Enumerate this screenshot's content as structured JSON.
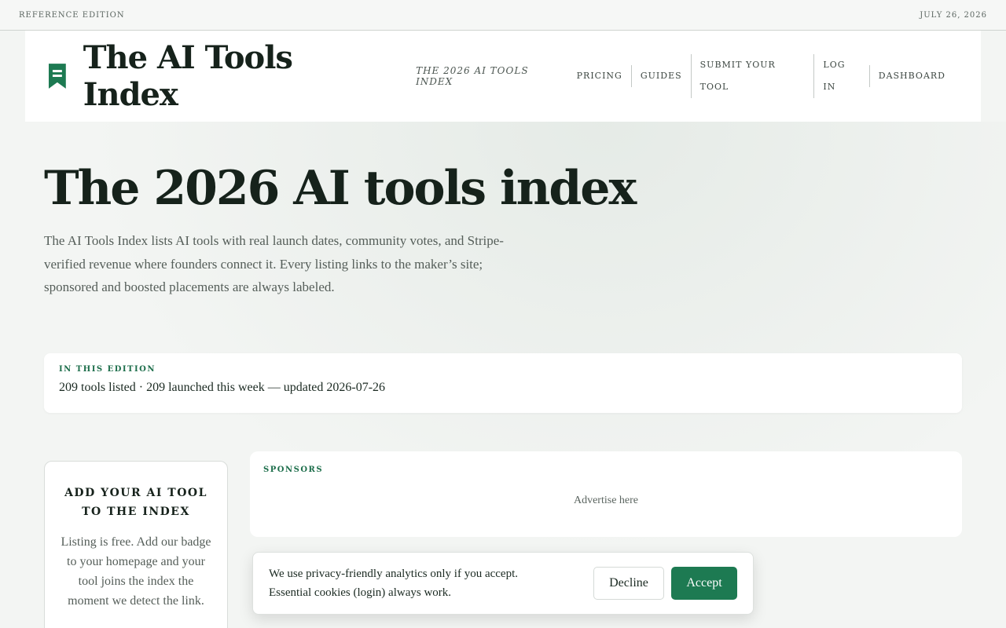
{
  "topbar": {
    "left": "REFERENCE EDITION",
    "right": "JULY 26, 2026"
  },
  "masthead": {
    "brand": "The AI Tools Index",
    "tagline": "THE 2026 AI TOOLS INDEX",
    "nav": [
      "PRICING",
      "GUIDES",
      "SUBMIT YOUR TOOL",
      "LOG IN",
      "DASHBOARD"
    ]
  },
  "hero": {
    "title": "The 2026 AI tools index",
    "description": "The AI Tools Index lists AI tools with real launch dates, community votes, and Stripe-verified revenue where founders connect it. Every listing links to the maker’s site; sponsored and boosted placements are always labeled."
  },
  "edition": {
    "eyebrow": "IN THIS EDITION",
    "summary": "209 tools listed · 209 launched this week — updated 2026-07-26"
  },
  "add_tool": {
    "title": "ADD YOUR AI TOOL TO THE INDEX",
    "text": "Listing is free. Add our badge to your homepage and your tool joins the index the moment we detect the link."
  },
  "sponsors": {
    "eyebrow": "SPONSORS",
    "cta": "Advertise here"
  },
  "cookie": {
    "text": "We use privacy-friendly analytics only if you accept. Essential cookies (login) always work.",
    "decline": "Decline",
    "accept": "Accept"
  },
  "colors": {
    "accent": "#1d7a52",
    "eyebrow": "#1d6e4b"
  },
  "icons": {
    "logo": "bookmark-icon"
  }
}
